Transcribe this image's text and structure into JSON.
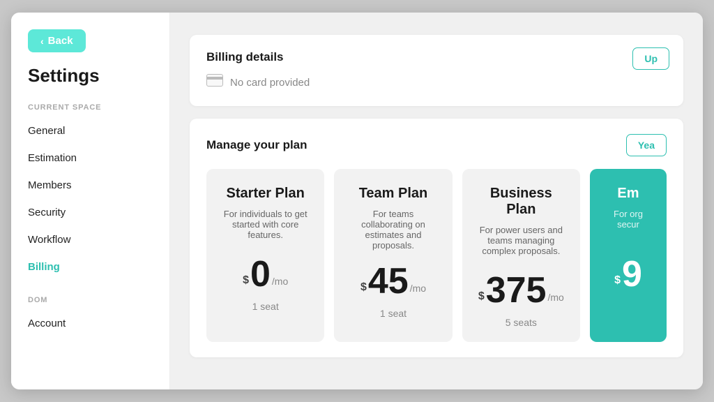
{
  "sidebar": {
    "back_label": "Back",
    "title": "Settings",
    "section1_label": "CURRENT SPACE",
    "items": [
      {
        "label": "General",
        "active": false
      },
      {
        "label": "Estimation",
        "active": false
      },
      {
        "label": "Members",
        "active": false
      },
      {
        "label": "Security",
        "active": false
      },
      {
        "label": "Workflow",
        "active": false
      },
      {
        "label": "Billing",
        "active": true
      }
    ],
    "section2_label": "DOM",
    "items2": [
      {
        "label": "Account",
        "active": false
      }
    ]
  },
  "billing": {
    "title": "Billing details",
    "no_card_text": "No card provided",
    "update_label": "Up",
    "card_icon": "💳"
  },
  "plan": {
    "title": "Manage your plan",
    "yearly_label": "Yea",
    "plans": [
      {
        "name": "Starter Plan",
        "desc": "For individuals to get started with core features.",
        "price_currency": "$",
        "price": "0",
        "price_mo": "/mo",
        "seats": "1 seat"
      },
      {
        "name": "Team Plan",
        "desc": "For teams collaborating on estimates and proposals.",
        "price_currency": "$",
        "price": "45",
        "price_mo": "/mo",
        "seats": "1 seat"
      },
      {
        "name": "Business Plan",
        "desc": "For power users and teams managing complex proposals.",
        "price_currency": "$",
        "price": "375",
        "price_mo": "/mo",
        "seats": "5 seats"
      },
      {
        "name": "Em",
        "desc": "For org secur",
        "price_currency": "$",
        "price": "9",
        "price_mo": "",
        "seats": ""
      }
    ]
  }
}
